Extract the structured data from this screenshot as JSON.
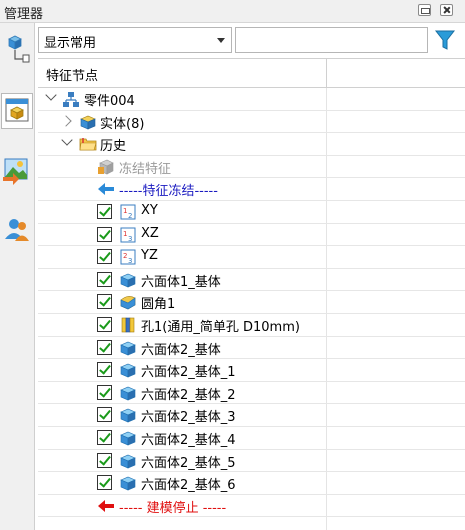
{
  "window": {
    "title": "管理器"
  },
  "filter": {
    "selected": "显示常用",
    "search_value": ""
  },
  "tree": {
    "column_header": "特征节点",
    "rows": [
      {
        "label": "零件004"
      },
      {
        "label": "实体(8)"
      },
      {
        "label": "历史"
      },
      {
        "label": "冻结特征"
      },
      {
        "label": "-----特征冻结-----"
      },
      {
        "label": "XY"
      },
      {
        "label": "XZ"
      },
      {
        "label": "YZ"
      },
      {
        "label": "六面体1_基体"
      },
      {
        "label": "圆角1"
      },
      {
        "label": "孔1(通用_简单孔 D10mm)"
      },
      {
        "label": "六面体2_基体"
      },
      {
        "label": "六面体2_基体_1"
      },
      {
        "label": "六面体2_基体_2"
      },
      {
        "label": "六面体2_基体_3"
      },
      {
        "label": "六面体2_基体_4"
      },
      {
        "label": "六面体2_基体_5"
      },
      {
        "label": "六面体2_基体_6"
      },
      {
        "label": "----- 建模停止 -----"
      }
    ]
  },
  "icons": {
    "freeze_marker": "arrow-left-blue-icon",
    "stop_marker": "arrow-left-red-icon",
    "part": "assembly-tree-icon",
    "solid": "solid-body-icon",
    "history": "folder-icon",
    "datum_plane": "datum-plane-icon",
    "box_feature": "cube-icon",
    "fillet": "fillet-icon",
    "hole": "hole-icon"
  },
  "colors": {
    "check_green": "#1a9a1a",
    "freeze_blue": "#1a1ac0",
    "stop_red": "#e01010",
    "cube_blue": "#3a8fd6"
  }
}
